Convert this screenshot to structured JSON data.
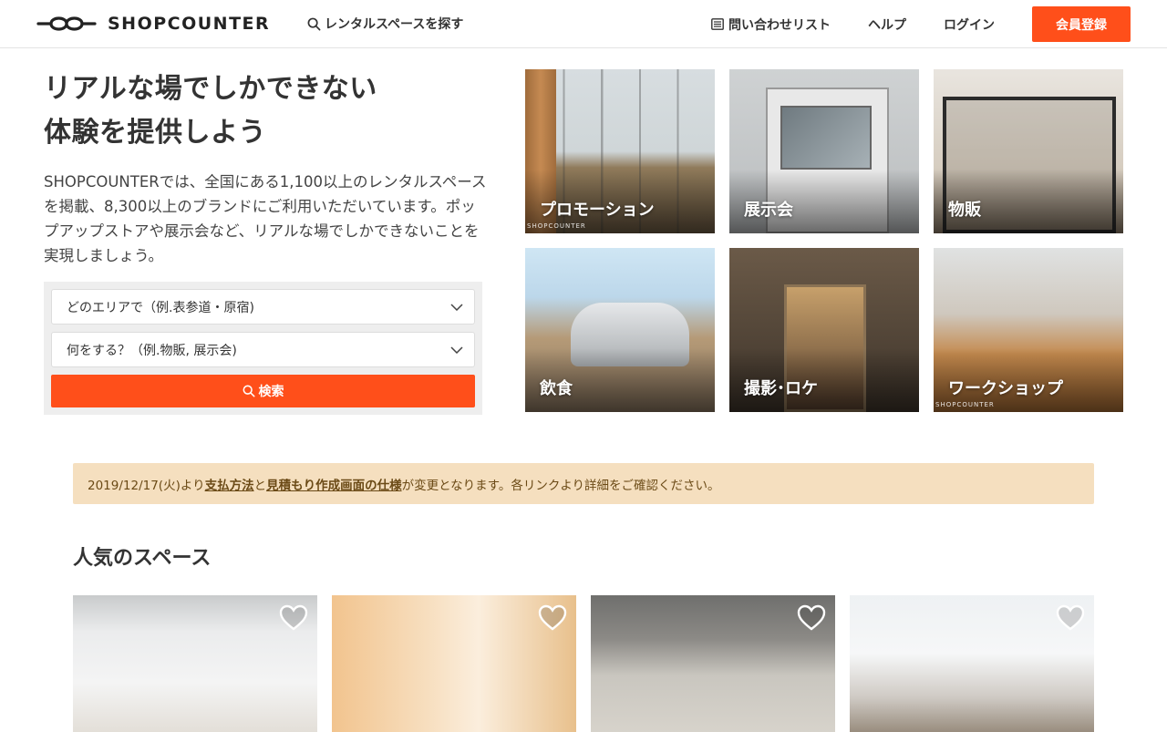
{
  "header": {
    "logo_text": "SHOPCOUNTER",
    "search_link": "レンタルスペースを探す",
    "contact_list": "問い合わせリスト",
    "help": "ヘルプ",
    "login": "ログイン",
    "signup": "会員登録"
  },
  "hero": {
    "title_line1": "リアルな場でしかできない",
    "title_line2": "体験を提供しよう",
    "description": "SHOPCOUNTERでは、全国にある1,100以上のレンタルスペースを掲載、8,300以上のブランドにご利用いただいています。ポップアップストアや展示会など、リアルな場でしかできないことを実現しましょう。"
  },
  "search": {
    "area_placeholder": "どのエリアで（例.表参道・原宿)",
    "purpose_placeholder": "何をする？（例.物販, 展示会)",
    "button_label": "検索"
  },
  "categories": [
    {
      "label": "プロモーション",
      "watermark": "SHOPCOUNTER"
    },
    {
      "label": "展示会"
    },
    {
      "label": "物販"
    },
    {
      "label": "飲食"
    },
    {
      "label": "撮影･ロケ"
    },
    {
      "label": "ワークショップ",
      "watermark": "SHOPCOUNTER"
    }
  ],
  "notice": {
    "prefix": "2019/12/17(火)より",
    "link1": "支払方法",
    "middle": "と",
    "link2": "見積もり作成画面の仕様",
    "suffix": "が変更となります。各リンクより詳細をご確認ください。"
  },
  "popular": {
    "title": "人気のスペース"
  },
  "colors": {
    "accent": "#ff4f1a",
    "notice_bg": "#f5dfbf",
    "notice_text": "#6b4a16"
  }
}
